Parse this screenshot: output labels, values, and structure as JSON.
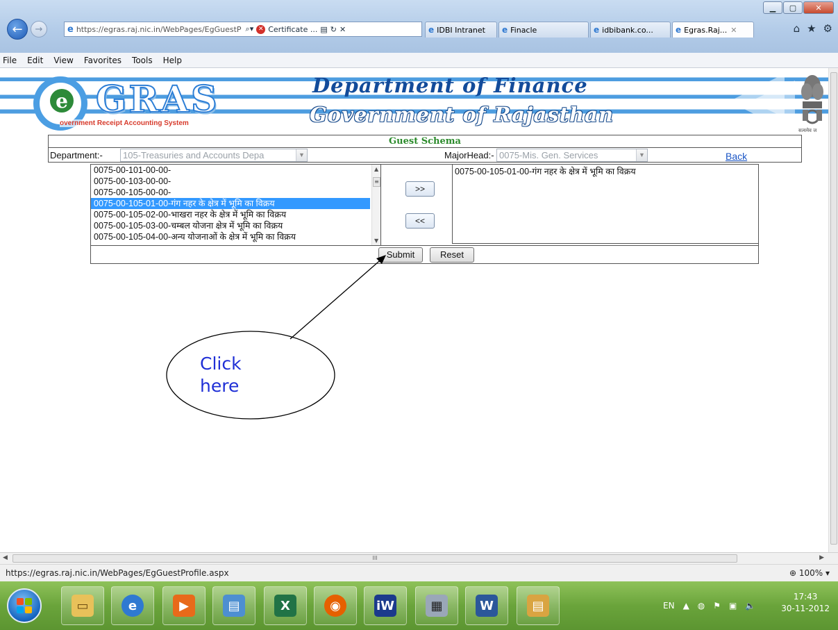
{
  "browser": {
    "address_url": "https://egras.raj.nic.in/WebPages/EgGuestP",
    "cert_label": "Certificate ...",
    "tabs": [
      "IDBI Intranet",
      "Finacle",
      "idbibank.co...",
      "Egras.Raj..."
    ],
    "menu": [
      "File",
      "Edit",
      "View",
      "Favorites",
      "Tools",
      "Help"
    ]
  },
  "header": {
    "logo_text": "GRAS",
    "logo_subtitle": "overnment Receipt Accounting System",
    "title_line1": "Department of Finance",
    "title_line2": "Government of Rajasthan",
    "emblem_caption": "सत्यमेव ज"
  },
  "form": {
    "schema_title": "Guest Schema",
    "department_label": "Department:-",
    "department_value": "105-Treasuries and Accounts Depa",
    "majorhead_label": "MajorHead:-",
    "majorhead_value": "0075-Mis. Gen. Services",
    "back_link": "Back",
    "available_items": [
      "0075-00-101-00-00-",
      "0075-00-103-00-00-",
      "0075-00-105-00-00-",
      "0075-00-105-01-00-गंग नहर के क्षेत्र में भूमि का विक्रय",
      "0075-00-105-02-00-भाखरा नहर के क्षेत्र में भूमि का विक्रय",
      "0075-00-105-03-00-चम्बल योजना क्षेत्र में भूमि का विक्रय",
      "0075-00-105-04-00-अन्य योजनाओं के क्षेत्र में भूमि का विक्रय"
    ],
    "selected_index": 3,
    "selected_items": [
      "0075-00-105-01-00-गंग नहर के क्षेत्र में भूमि का विक्रय"
    ],
    "add_button": ">>",
    "remove_button": "<<",
    "submit_button": "Submit",
    "reset_button": "Reset"
  },
  "annotation": {
    "line1": "Click",
    "line2": "here"
  },
  "status": {
    "url": "https://egras.raj.nic.in/WebPages/EgGuestProfile.aspx",
    "zoom": "100%"
  },
  "taskbar": {
    "lang": "EN",
    "time": "17:43",
    "date": "30-11-2012"
  },
  "colors": {
    "brand_blue": "#124b9a",
    "accent_green": "#2a8a2a",
    "selection_blue": "#3399ff",
    "annotation_text": "#1f2fd6"
  }
}
